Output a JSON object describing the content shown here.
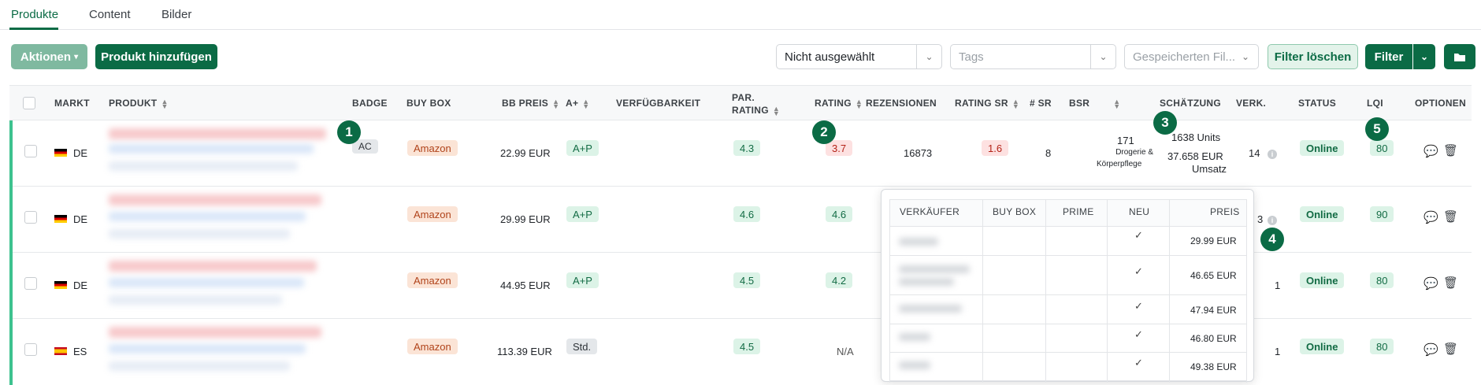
{
  "tabs": [
    {
      "label": "Produkte",
      "active": true
    },
    {
      "label": "Content"
    },
    {
      "label": "Bilder"
    }
  ],
  "toolbar": {
    "actions_label": "Aktionen",
    "add_label": "Produkt hinzufügen",
    "select1_value": "Nicht ausgewählt",
    "tags_placeholder": "Tags",
    "saved_placeholder": "Gespeicherten Fil...",
    "clear_label": "Filter löschen",
    "filter_label": "Filter"
  },
  "columns": {
    "markt": "MARKT",
    "produkt": "PRODUKT",
    "badge": "BADGE",
    "buybox": "BUY BOX",
    "bbpreis": "BB PREIS",
    "aplus": "A+",
    "verf": "VERFÜGBARKEIT",
    "par1": "PAR.",
    "par2": "RATING",
    "rating": "RATING",
    "rez": "REZENSIONEN",
    "ratingsr": "RATING SR",
    "nsr": "# SR",
    "bsr": "BSR",
    "schaetzung": "SCHÄTZUNG",
    "verk": "VERK.",
    "status": "STATUS",
    "lqi": "LQI",
    "optionen": "OPTIONEN"
  },
  "rows": [
    {
      "markt": "DE",
      "badge": "AC",
      "buybox": "Amazon",
      "bbpreis": "22.99 EUR",
      "aplus": "A+P",
      "par": "4.3",
      "rating": "3.7",
      "rez": "16873",
      "ratingsr": "1.6",
      "nsr": "8",
      "bsr_num": "171",
      "bsr_cat1": "Drogerie &",
      "bsr_cat2": "Körperpflege",
      "est_units": "1638 Units",
      "est_rev1": "37.658 EUR",
      "est_rev2": "Umsatz",
      "verk": "14",
      "status": "Online",
      "lqi": "80"
    },
    {
      "markt": "DE",
      "badge": "",
      "buybox": "Amazon",
      "bbpreis": "29.99 EUR",
      "aplus": "A+P",
      "par": "4.6",
      "rating": "4.6",
      "verk": "3",
      "status": "Online",
      "lqi": "90"
    },
    {
      "markt": "DE",
      "badge": "",
      "buybox": "Amazon",
      "bbpreis": "44.95 EUR",
      "aplus": "A+P",
      "par": "4.5",
      "rating": "4.2",
      "verk": "1",
      "status": "Online",
      "lqi": "80"
    },
    {
      "markt": "ES",
      "badge": "",
      "buybox": "Amazon",
      "bbpreis": "113.39 EUR",
      "aplus": "Std.",
      "par": "4.5",
      "rating": "N/A",
      "verk": "1",
      "status": "Online",
      "lqi": "80"
    }
  ],
  "popup": {
    "headers": {
      "seller": "VERKÄUFER",
      "buybox": "BUY BOX",
      "prime": "PRIME",
      "neu": "NEU",
      "preis": "PREIS"
    },
    "prices": [
      "29.99 EUR",
      "46.65 EUR",
      "47.94 EUR",
      "46.80 EUR",
      "49.38 EUR"
    ]
  },
  "markers": [
    "1",
    "2",
    "3",
    "4",
    "5"
  ],
  "colors": {
    "brand": "#0b6b45",
    "accent_row": "#3ec28f"
  }
}
